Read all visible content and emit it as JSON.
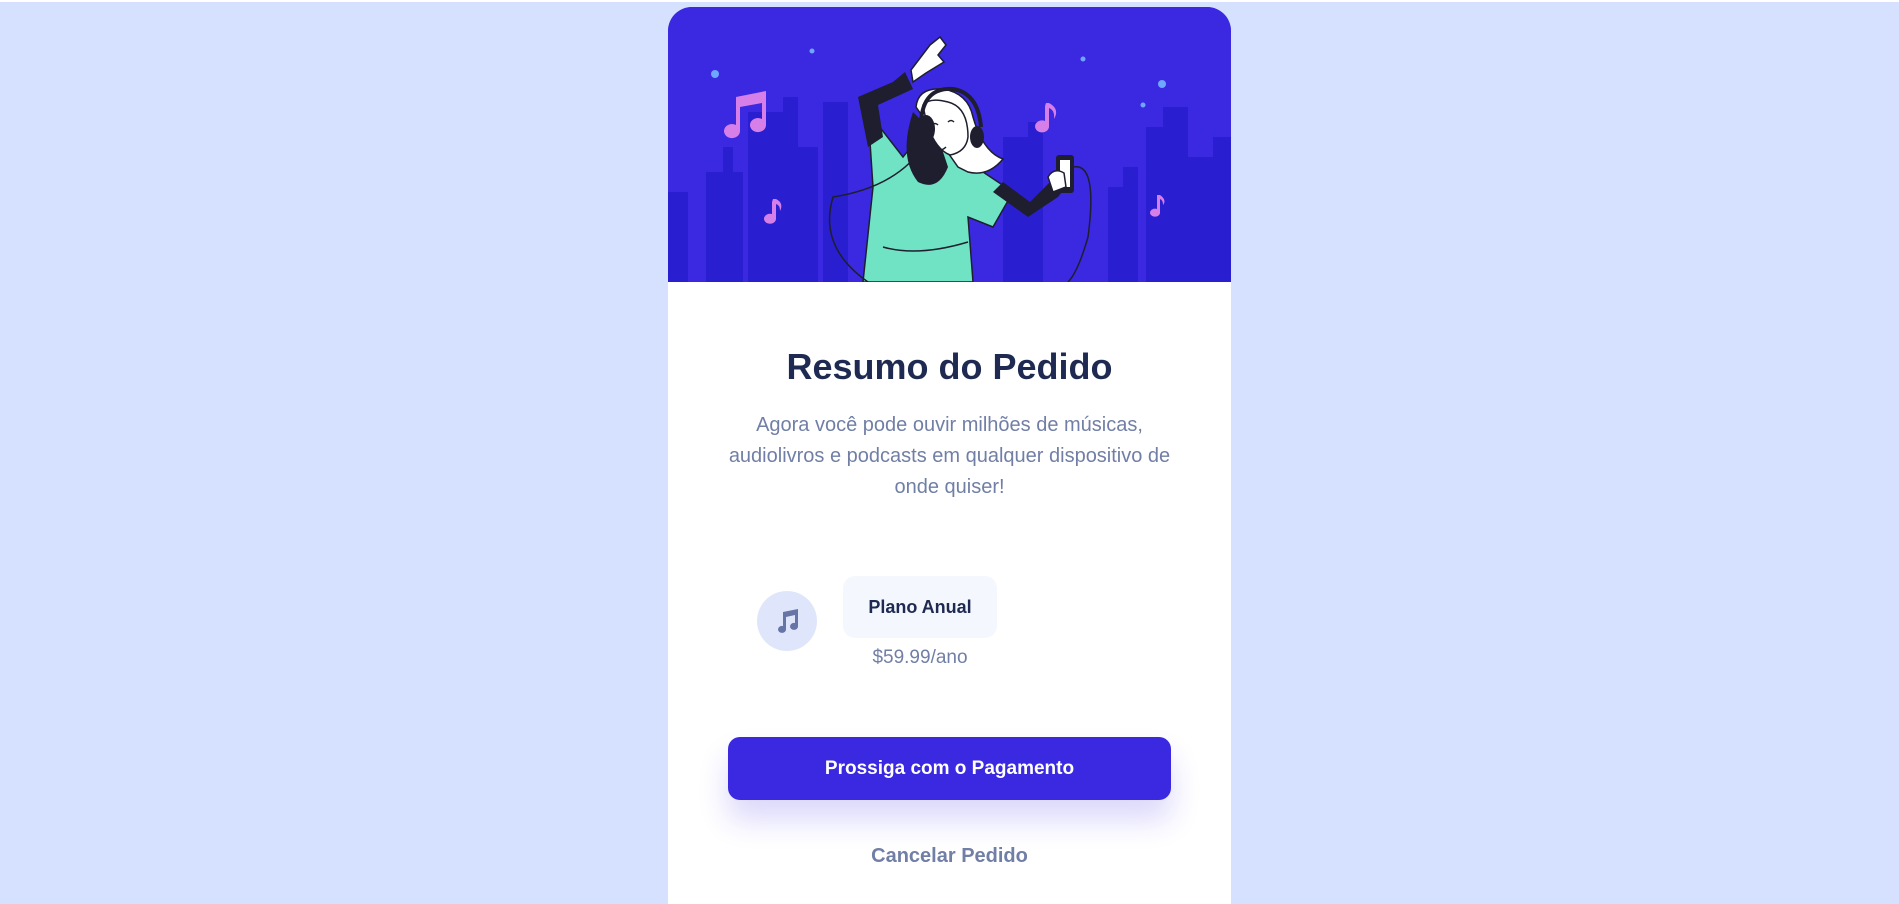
{
  "summary": {
    "title": "Resumo do Pedido",
    "description": "Agora você pode ouvir milhões de músicas, audiolivros e podcasts em qualquer dispositivo de onde quiser!"
  },
  "plan": {
    "icon": "music-note-icon",
    "name": "Plano Anual",
    "price": "$59.99/ano"
  },
  "actions": {
    "proceed_label": "Prossiga com o Pagamento",
    "cancel_label": "Cancelar Pedido"
  },
  "colors": {
    "page_background": "#d6e0ff",
    "accent": "#3a29e1",
    "heading": "#1e2a52",
    "muted_text": "#717fa6",
    "illustration_mint": "#6fe3c4",
    "illustration_note": "#d67fe8"
  }
}
